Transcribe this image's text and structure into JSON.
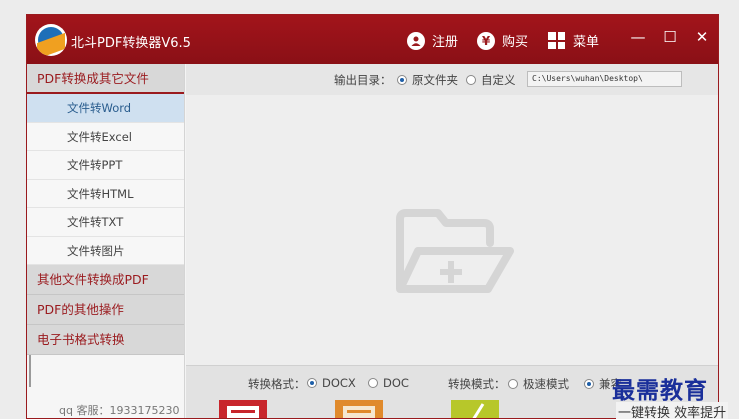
{
  "titlebar": {
    "title": "北斗PDF转换器V6.5",
    "register_label": "注册",
    "buy_label": "购买",
    "buy_icon": "¥",
    "menu_label": "菜单",
    "minimize": "—",
    "maximize": "☐",
    "close": "✕"
  },
  "sidebar": {
    "cat1": "PDF转换成其它文件",
    "items": [
      "文件转Word",
      "文件转Excel",
      "文件转PPT",
      "文件转HTML",
      "文件转TXT",
      "文件转图片"
    ],
    "cat2": "其他文件转换成PDF",
    "cat3": "PDF的其他操作",
    "cat4": "电子书格式转换",
    "qq": "qq 客服：1933175230"
  },
  "outbar": {
    "label": "输出目录：",
    "opt_source": "原文件夹",
    "opt_custom": "自定义",
    "path": "C:\\Users\\wuhan\\Desktop\\"
  },
  "bottom": {
    "format_label": "转换格式：",
    "docx": "DOCX",
    "doc": "DOC",
    "mode_label": "转换模式：",
    "fast": "极速模式",
    "compat": "兼容"
  },
  "overlay": {
    "watermark": "最需教育",
    "slogan": "一键转换 效率提升"
  },
  "colors": {
    "accent": "#9a1a1e",
    "active_bg": "#cfe0f0"
  }
}
